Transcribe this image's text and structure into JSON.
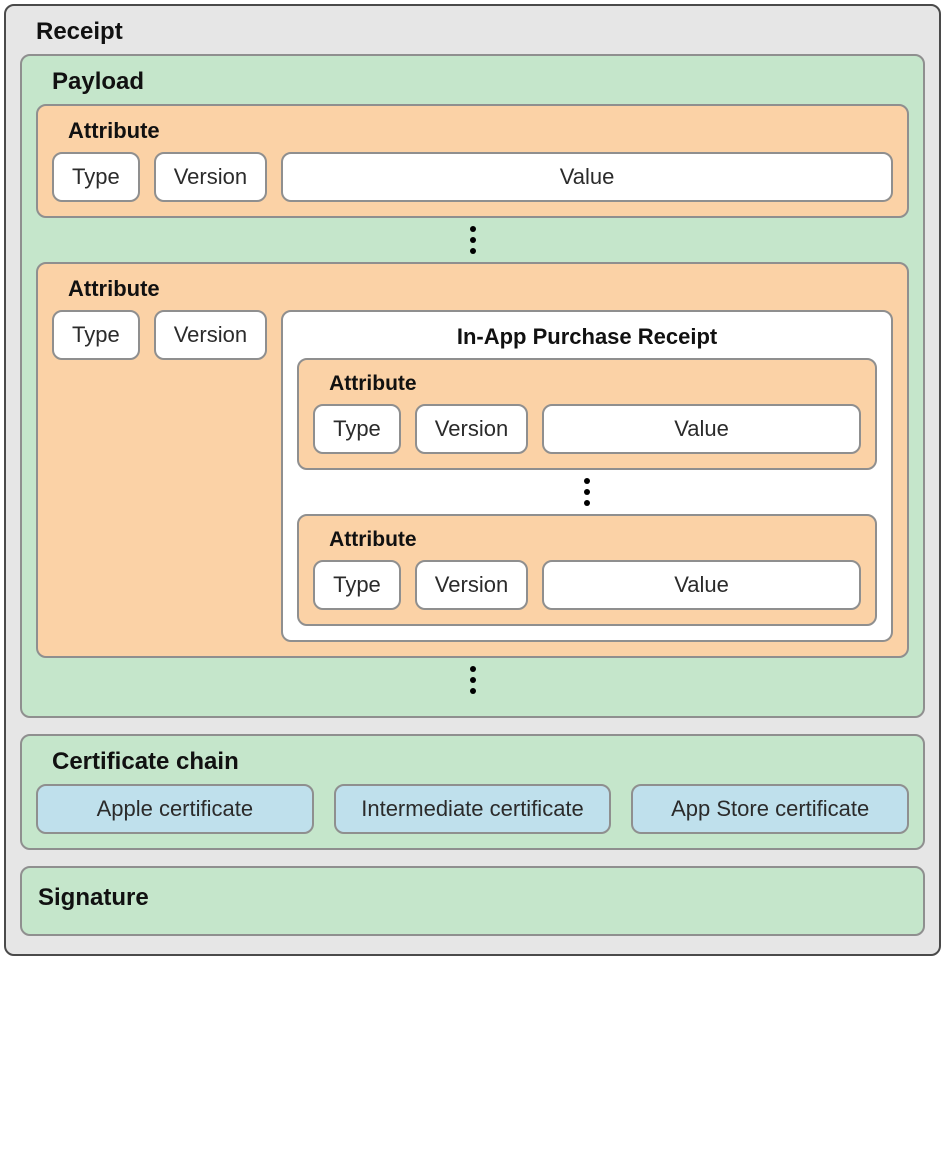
{
  "receipt": {
    "title": "Receipt",
    "payload": {
      "title": "Payload",
      "attribute1": {
        "title": "Attribute",
        "type": "Type",
        "version": "Version",
        "value": "Value"
      },
      "attribute2": {
        "title": "Attribute",
        "type": "Type",
        "version": "Version",
        "iap": {
          "title": "In-App Purchase Receipt",
          "attr1": {
            "title": "Attribute",
            "type": "Type",
            "version": "Version",
            "value": "Value"
          },
          "attr2": {
            "title": "Attribute",
            "type": "Type",
            "version": "Version",
            "value": "Value"
          }
        }
      }
    },
    "cert_chain": {
      "title": "Certificate chain",
      "certs": [
        "Apple certificate",
        "Intermediate certificate",
        "App Store certificate"
      ]
    },
    "signature": {
      "title": "Signature"
    }
  }
}
